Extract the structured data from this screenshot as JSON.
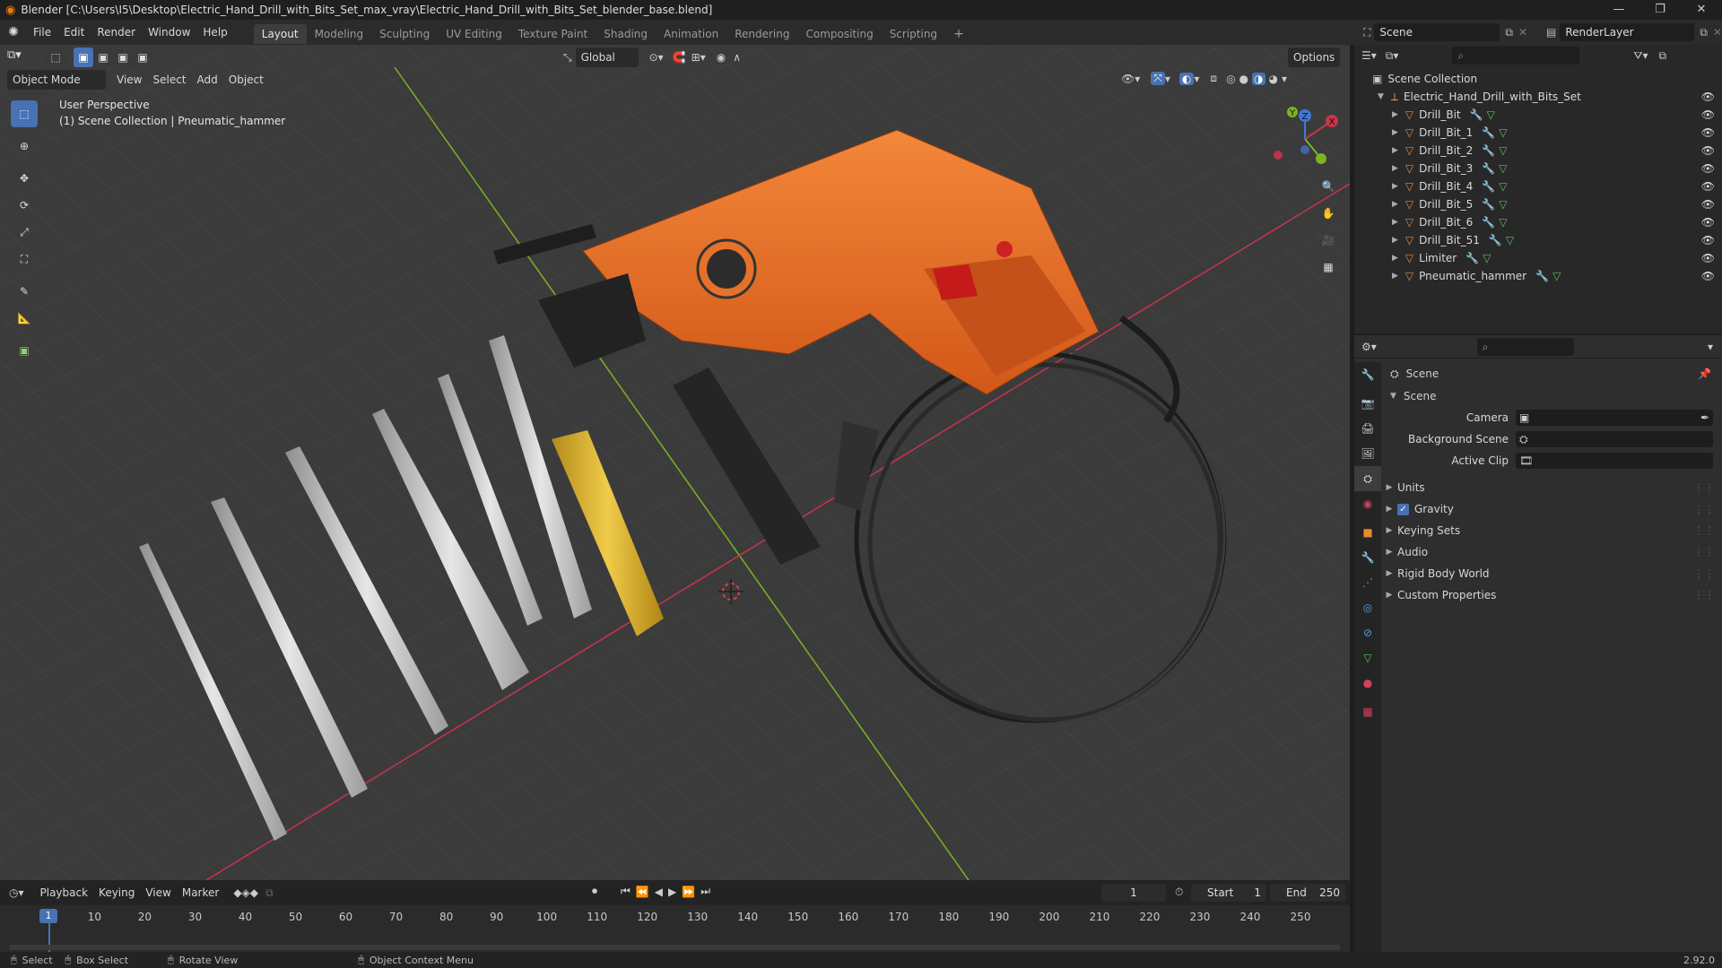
{
  "window": {
    "title": "Blender [C:\\Users\\I5\\Desktop\\Electric_Hand_Drill_with_Bits_Set_max_vray\\Electric_Hand_Drill_with_Bits_Set_blender_base.blend]",
    "minimize": "—",
    "maximize": "❐",
    "close": "✕"
  },
  "menus": [
    "File",
    "Edit",
    "Render",
    "Window",
    "Help"
  ],
  "workspaces": {
    "tabs": [
      "Layout",
      "Modeling",
      "Sculpting",
      "UV Editing",
      "Texture Paint",
      "Shading",
      "Animation",
      "Rendering",
      "Compositing",
      "Scripting"
    ],
    "active": "Layout",
    "add": "+"
  },
  "scene_selector": {
    "value": "Scene"
  },
  "view_layer_selector": {
    "value": "RenderLayer"
  },
  "viewport": {
    "mode": "Object Mode",
    "menus": [
      "View",
      "Select",
      "Add",
      "Object"
    ],
    "transform_orientation": "Global",
    "options_label": "Options",
    "overlay_line1": "User Perspective",
    "overlay_line2": "(1) Scene Collection | Pneumatic_hammer",
    "gizmo_axes": {
      "x": "X",
      "y": "Y",
      "z": "Z"
    }
  },
  "outliner": {
    "root": "Scene Collection",
    "collection": "Electric_Hand_Drill_with_Bits_Set",
    "objects": [
      "Drill_Bit",
      "Drill_Bit_1",
      "Drill_Bit_2",
      "Drill_Bit_3",
      "Drill_Bit_4",
      "Drill_Bit_5",
      "Drill_Bit_6",
      "Drill_Bit_51",
      "Limiter",
      "Pneumatic_hammer"
    ]
  },
  "properties": {
    "header": "Scene",
    "panel_title": "Scene",
    "fields": [
      {
        "label": "Camera"
      },
      {
        "label": "Background Scene"
      },
      {
        "label": "Active Clip"
      }
    ],
    "subpanels": [
      "Units",
      "Gravity",
      "Keying Sets",
      "Audio",
      "Rigid Body World",
      "Custom Properties"
    ],
    "gravity_checked": true
  },
  "timeline": {
    "menus": [
      "Playback",
      "Keying",
      "View",
      "Marker"
    ],
    "current_frame": "1",
    "start_label": "Start",
    "start_value": "1",
    "end_label": "End",
    "end_value": "250",
    "ruler_current": "1",
    "ruler": [
      "10",
      "20",
      "30",
      "40",
      "50",
      "60",
      "70",
      "80",
      "90",
      "100",
      "110",
      "120",
      "130",
      "140",
      "150",
      "160",
      "170",
      "180",
      "190",
      "200",
      "210",
      "220",
      "230",
      "240",
      "250"
    ]
  },
  "statusbar": {
    "items": [
      "Select",
      "Box Select",
      "Rotate View",
      "Object Context Menu"
    ],
    "version": "2.92.0"
  },
  "colors": {
    "accent": "#4772b3",
    "axis_x": "#c9344a",
    "axis_y": "#7bb321",
    "axis_z": "#3e78d6",
    "drill_orange": "#e86a22"
  }
}
